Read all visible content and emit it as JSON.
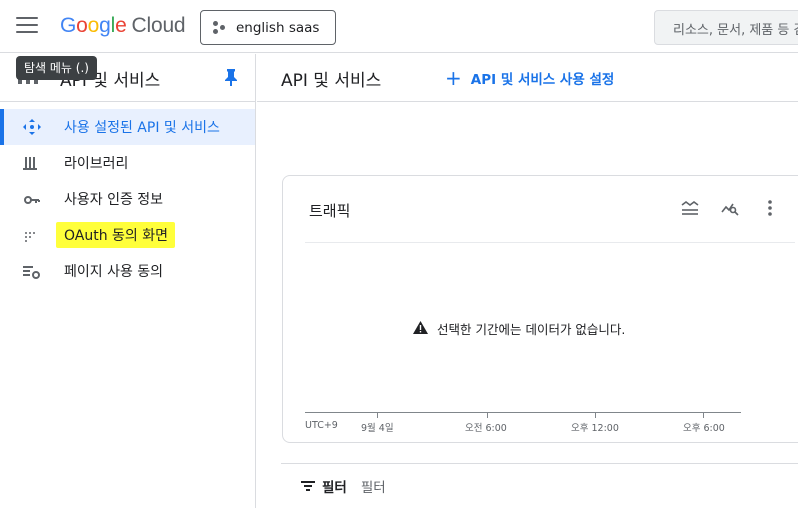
{
  "header": {
    "logo_google": "Google",
    "logo_cloud": "Cloud",
    "project": "english saas",
    "search_placeholder": "리소스, 문서, 제품 등 검"
  },
  "tooltip": "탐색 메뉴 (.)",
  "sidebar": {
    "title": "API 및 서비스",
    "items": [
      {
        "label": "사용 설정된 API 및 서비스",
        "icon": "api-diamond-icon",
        "active": true
      },
      {
        "label": "라이브러리",
        "icon": "library-icon"
      },
      {
        "label": "사용자 인증 정보",
        "icon": "key-icon"
      },
      {
        "label": "OAuth 동의 화면",
        "icon": "oauth-dots-icon",
        "highlighted": true
      },
      {
        "label": "페이지 사용 동의",
        "icon": "settings-list-icon"
      }
    ]
  },
  "main": {
    "title": "API 및 서비스",
    "enable_button": "API 및 서비스 사용 설정"
  },
  "traffic_card": {
    "title": "트래픽",
    "empty_message": "선택한 기간에는 데이터가 없습니다.",
    "x_labels": [
      "UTC+9",
      "9월 4일",
      "오전 6:00",
      "오후 12:00",
      "오후 6:00"
    ]
  },
  "filter": {
    "label": "필터",
    "placeholder": "필터"
  },
  "colors": {
    "accent": "#1a73e8",
    "highlight": "#ffff3b",
    "active_bg": "#e8f0fe"
  }
}
